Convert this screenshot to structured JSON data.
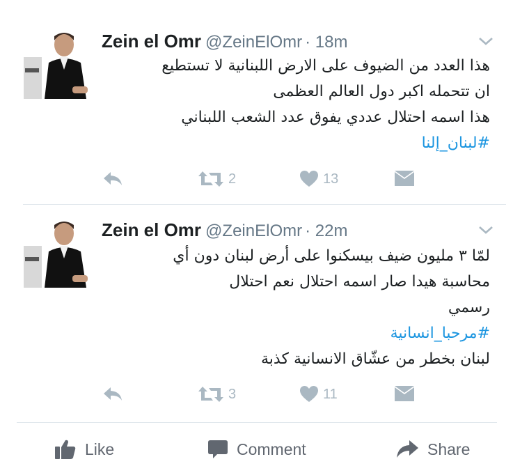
{
  "tweets": [
    {
      "name": "Zein el Omr",
      "handle": "@ZeinElOmr",
      "time": "· 18m",
      "lines": [
        "هذا العدد من الضيوف على الارض اللبنانية لا تستطيع",
        "ان تتحمله اكبر دول العالم العظمى",
        "هذا اسمه احتلال عددي يفوق عدد الشعب اللبناني"
      ],
      "hashtag": "#لبنان_إلنا",
      "retweets": "2",
      "likes": "13"
    },
    {
      "name": "Zein el Omr",
      "handle": "@ZeinElOmr",
      "time": "· 22m",
      "lines": [
        "لمّا ٣ مليون ضيف بيسكنوا على أرض لبنان دون أي",
        "محاسبة هيدا صار اسمه احتلال نعم احتلال",
        "رسمي"
      ],
      "hashtag": "#مرحبا_انسانية",
      "after_hashtag": "لبنان بخطر من عشّاق الانسانية كذبة",
      "retweets": "3",
      "likes": "11"
    }
  ],
  "facebook_bar": {
    "like": "Like",
    "comment": "Comment",
    "share": "Share"
  },
  "colors": {
    "name": "#1c2022",
    "secondary": "#657786",
    "hashtag": "#1b95e0",
    "action_icon": "#aab8c2",
    "divider": "#e1e8ed",
    "fb_text": "#616770"
  }
}
